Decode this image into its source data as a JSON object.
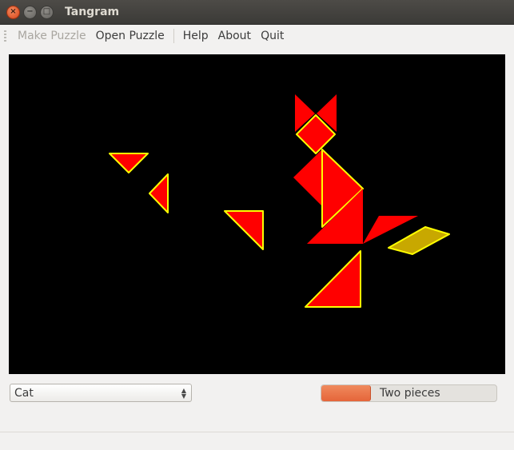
{
  "window": {
    "title": "Tangram"
  },
  "menu": {
    "items": [
      {
        "label": "Make Puzzle",
        "enabled": false
      },
      {
        "label": "Open Puzzle",
        "enabled": true
      },
      {
        "label": "Help",
        "enabled": true
      },
      {
        "label": "About",
        "enabled": true
      },
      {
        "label": "Quit",
        "enabled": true
      }
    ]
  },
  "puzzle_select": {
    "value": "Cat"
  },
  "progress": {
    "label": "Two pieces",
    "fraction": 0.28
  },
  "colors": {
    "piece_fill": "#ff0000",
    "piece_outline": "#ffff00",
    "selected_fill": "#c8a800",
    "canvas_bg": "#000000",
    "progress_fill": "#e9724a"
  }
}
